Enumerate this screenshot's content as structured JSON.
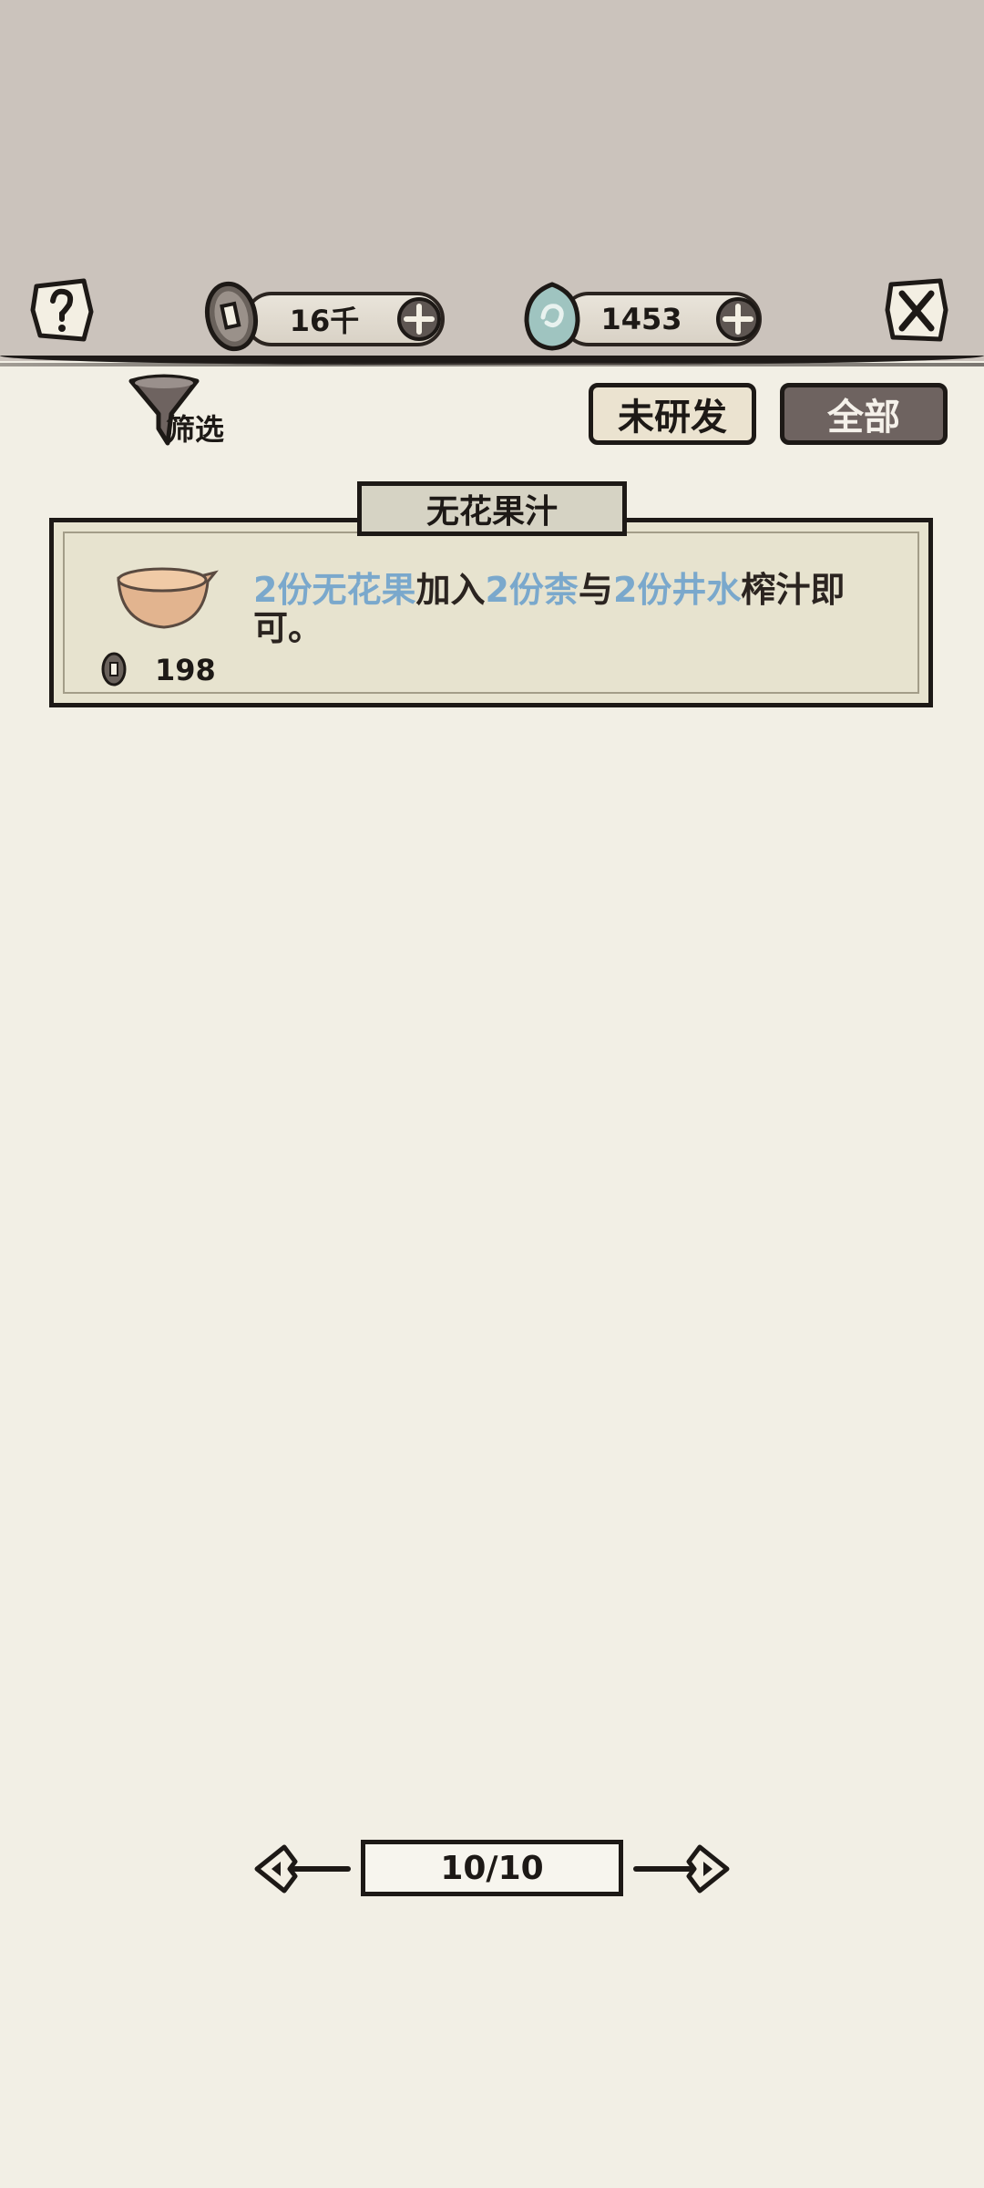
{
  "header": {
    "coin_amount": "16千",
    "jade_amount": "1453"
  },
  "filter": {
    "label": "筛选"
  },
  "tabs": [
    {
      "label": "未研发"
    },
    {
      "label": "全部"
    }
  ],
  "recipe": {
    "title": "无花果汁",
    "price": "198",
    "description_parts": [
      {
        "text": "2份无花果",
        "highlight": true
      },
      {
        "text": "加入",
        "highlight": false
      },
      {
        "text": "2份柰",
        "highlight": true
      },
      {
        "text": "与",
        "highlight": false
      },
      {
        "text": "2份井水",
        "highlight": true
      },
      {
        "text": "榨汁即可。",
        "highlight": false
      }
    ]
  },
  "pager": {
    "label": "10/10"
  },
  "colors": {
    "highlight": "#7aa8cc",
    "ink": "#1d1916",
    "paper": "#f2efe5",
    "topbar": "#cbc3bc"
  },
  "icons": {
    "help": "help-scroll-icon",
    "close": "close-scroll-icon",
    "coin": "copper-coin-icon",
    "jade": "jade-icon",
    "plus": "plus-icon",
    "filter": "funnel-icon",
    "bowl": "bowl-icon",
    "prev": "arrow-left-icon",
    "next": "arrow-right-icon"
  }
}
